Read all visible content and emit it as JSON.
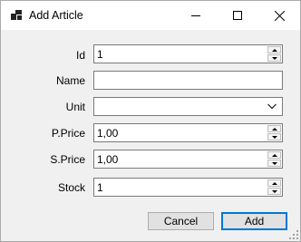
{
  "window": {
    "title": "Add Article"
  },
  "icons": {
    "app": "app-icon",
    "minimize": "minimize-icon",
    "maximize": "maximize-icon",
    "close": "close-icon"
  },
  "form": {
    "fields": [
      {
        "label": "Id",
        "value": "1",
        "type": "numeric"
      },
      {
        "label": "Name",
        "value": "",
        "type": "text"
      },
      {
        "label": "Unit",
        "value": "",
        "type": "dropdown"
      },
      {
        "label": "P.Price",
        "value": "1,00",
        "type": "numeric"
      },
      {
        "label": "S.Price",
        "value": "1,00",
        "type": "numeric"
      },
      {
        "label": "Stock",
        "value": "1",
        "type": "numeric"
      }
    ]
  },
  "buttons": {
    "cancel": "Cancel",
    "add": "Add"
  }
}
